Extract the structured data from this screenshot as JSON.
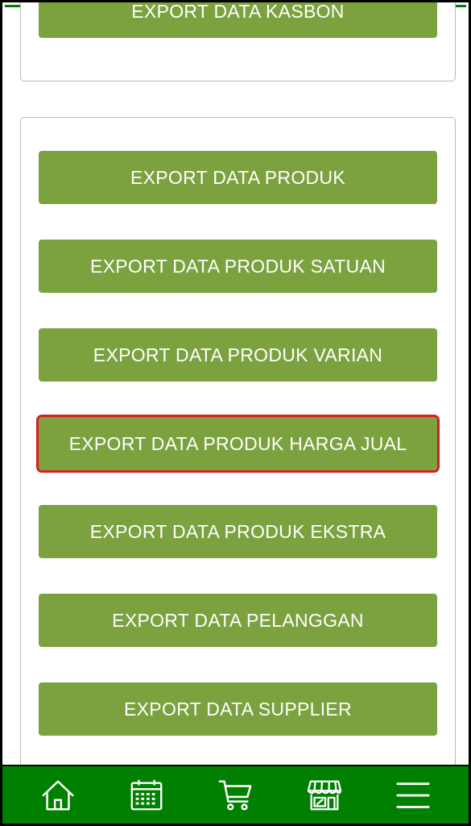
{
  "buttons": {
    "kasbon": "EXPORT DATA KASBON",
    "produk": "EXPORT DATA PRODUK",
    "produk_satuan": "EXPORT DATA PRODUK SATUAN",
    "produk_varian": "EXPORT DATA PRODUK VARIAN",
    "produk_harga_jual": "EXPORT DATA PRODUK HARGA JUAL",
    "produk_ekstra": "EXPORT DATA PRODUK EKSTRA",
    "pelanggan": "EXPORT DATA PELANGGAN",
    "supplier": "EXPORT DATA SUPPLIER"
  },
  "bottom_nav": [
    {
      "icon": "home-icon"
    },
    {
      "icon": "calendar-icon"
    },
    {
      "icon": "cart-icon"
    },
    {
      "icon": "store-icon"
    },
    {
      "icon": "menu-icon"
    }
  ],
  "colors": {
    "button_bg": "#7ca13f",
    "nav_bg": "#008000",
    "highlight": "#d91c1c"
  }
}
